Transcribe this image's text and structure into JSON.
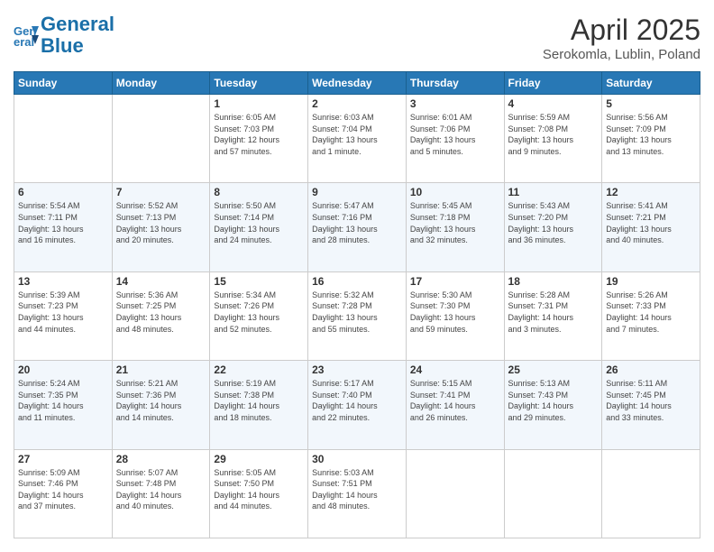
{
  "header": {
    "logo_line1": "General",
    "logo_line2": "Blue",
    "title": "April 2025",
    "subtitle": "Serokomla, Lublin, Poland"
  },
  "calendar": {
    "weekdays": [
      "Sunday",
      "Monday",
      "Tuesday",
      "Wednesday",
      "Thursday",
      "Friday",
      "Saturday"
    ],
    "weeks": [
      [
        {
          "day": "",
          "info": ""
        },
        {
          "day": "",
          "info": ""
        },
        {
          "day": "1",
          "info": "Sunrise: 6:05 AM\nSunset: 7:03 PM\nDaylight: 12 hours\nand 57 minutes."
        },
        {
          "day": "2",
          "info": "Sunrise: 6:03 AM\nSunset: 7:04 PM\nDaylight: 13 hours\nand 1 minute."
        },
        {
          "day": "3",
          "info": "Sunrise: 6:01 AM\nSunset: 7:06 PM\nDaylight: 13 hours\nand 5 minutes."
        },
        {
          "day": "4",
          "info": "Sunrise: 5:59 AM\nSunset: 7:08 PM\nDaylight: 13 hours\nand 9 minutes."
        },
        {
          "day": "5",
          "info": "Sunrise: 5:56 AM\nSunset: 7:09 PM\nDaylight: 13 hours\nand 13 minutes."
        }
      ],
      [
        {
          "day": "6",
          "info": "Sunrise: 5:54 AM\nSunset: 7:11 PM\nDaylight: 13 hours\nand 16 minutes."
        },
        {
          "day": "7",
          "info": "Sunrise: 5:52 AM\nSunset: 7:13 PM\nDaylight: 13 hours\nand 20 minutes."
        },
        {
          "day": "8",
          "info": "Sunrise: 5:50 AM\nSunset: 7:14 PM\nDaylight: 13 hours\nand 24 minutes."
        },
        {
          "day": "9",
          "info": "Sunrise: 5:47 AM\nSunset: 7:16 PM\nDaylight: 13 hours\nand 28 minutes."
        },
        {
          "day": "10",
          "info": "Sunrise: 5:45 AM\nSunset: 7:18 PM\nDaylight: 13 hours\nand 32 minutes."
        },
        {
          "day": "11",
          "info": "Sunrise: 5:43 AM\nSunset: 7:20 PM\nDaylight: 13 hours\nand 36 minutes."
        },
        {
          "day": "12",
          "info": "Sunrise: 5:41 AM\nSunset: 7:21 PM\nDaylight: 13 hours\nand 40 minutes."
        }
      ],
      [
        {
          "day": "13",
          "info": "Sunrise: 5:39 AM\nSunset: 7:23 PM\nDaylight: 13 hours\nand 44 minutes."
        },
        {
          "day": "14",
          "info": "Sunrise: 5:36 AM\nSunset: 7:25 PM\nDaylight: 13 hours\nand 48 minutes."
        },
        {
          "day": "15",
          "info": "Sunrise: 5:34 AM\nSunset: 7:26 PM\nDaylight: 13 hours\nand 52 minutes."
        },
        {
          "day": "16",
          "info": "Sunrise: 5:32 AM\nSunset: 7:28 PM\nDaylight: 13 hours\nand 55 minutes."
        },
        {
          "day": "17",
          "info": "Sunrise: 5:30 AM\nSunset: 7:30 PM\nDaylight: 13 hours\nand 59 minutes."
        },
        {
          "day": "18",
          "info": "Sunrise: 5:28 AM\nSunset: 7:31 PM\nDaylight: 14 hours\nand 3 minutes."
        },
        {
          "day": "19",
          "info": "Sunrise: 5:26 AM\nSunset: 7:33 PM\nDaylight: 14 hours\nand 7 minutes."
        }
      ],
      [
        {
          "day": "20",
          "info": "Sunrise: 5:24 AM\nSunset: 7:35 PM\nDaylight: 14 hours\nand 11 minutes."
        },
        {
          "day": "21",
          "info": "Sunrise: 5:21 AM\nSunset: 7:36 PM\nDaylight: 14 hours\nand 14 minutes."
        },
        {
          "day": "22",
          "info": "Sunrise: 5:19 AM\nSunset: 7:38 PM\nDaylight: 14 hours\nand 18 minutes."
        },
        {
          "day": "23",
          "info": "Sunrise: 5:17 AM\nSunset: 7:40 PM\nDaylight: 14 hours\nand 22 minutes."
        },
        {
          "day": "24",
          "info": "Sunrise: 5:15 AM\nSunset: 7:41 PM\nDaylight: 14 hours\nand 26 minutes."
        },
        {
          "day": "25",
          "info": "Sunrise: 5:13 AM\nSunset: 7:43 PM\nDaylight: 14 hours\nand 29 minutes."
        },
        {
          "day": "26",
          "info": "Sunrise: 5:11 AM\nSunset: 7:45 PM\nDaylight: 14 hours\nand 33 minutes."
        }
      ],
      [
        {
          "day": "27",
          "info": "Sunrise: 5:09 AM\nSunset: 7:46 PM\nDaylight: 14 hours\nand 37 minutes."
        },
        {
          "day": "28",
          "info": "Sunrise: 5:07 AM\nSunset: 7:48 PM\nDaylight: 14 hours\nand 40 minutes."
        },
        {
          "day": "29",
          "info": "Sunrise: 5:05 AM\nSunset: 7:50 PM\nDaylight: 14 hours\nand 44 minutes."
        },
        {
          "day": "30",
          "info": "Sunrise: 5:03 AM\nSunset: 7:51 PM\nDaylight: 14 hours\nand 48 minutes."
        },
        {
          "day": "",
          "info": ""
        },
        {
          "day": "",
          "info": ""
        },
        {
          "day": "",
          "info": ""
        }
      ]
    ]
  }
}
